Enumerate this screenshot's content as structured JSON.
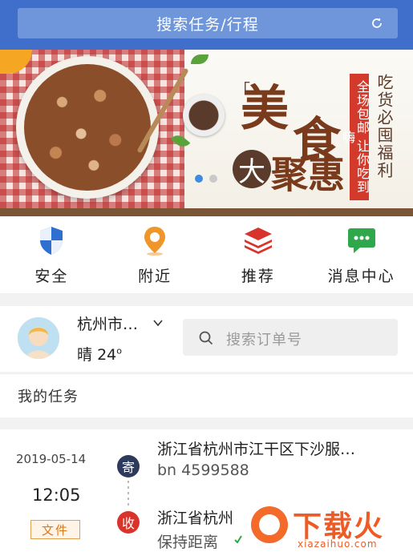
{
  "top_search": {
    "label": "搜索任务/行程",
    "icon": "refresh-icon"
  },
  "banner": {
    "headline_1": "美",
    "headline_2": "食",
    "headline_3": "大",
    "headline_4": "聚惠",
    "red_tag": "全场包邮 让你吃到嗨",
    "vertical_text": "吃货必囤福利",
    "bracket_left": "「",
    "pager_total": 2,
    "pager_active": 1
  },
  "quick_nav": [
    {
      "label": "安全",
      "icon": "shield-icon",
      "color": "#2f6fd0"
    },
    {
      "label": "附近",
      "icon": "location-pin-icon",
      "color": "#f0952a"
    },
    {
      "label": "推荐",
      "icon": "layers-icon",
      "color": "#d9342b"
    },
    {
      "label": "消息中心",
      "icon": "chat-icon",
      "color": "#2ea84b"
    }
  ],
  "location": {
    "city": "杭州市…",
    "weather_label": "晴",
    "temperature": "24",
    "temp_unit": "o",
    "order_search_placeholder": "搜索订单号"
  },
  "task_section": {
    "title": "我的任务"
  },
  "task": {
    "date": "2019-05-14",
    "time": "12:05",
    "badge": "文件",
    "from_marker": "寄",
    "from_address": "浙江省杭州市江干区下沙服…",
    "from_number": "bn 4599588",
    "to_marker": "收",
    "to_address": "浙江省杭州",
    "to_note": "保持距离"
  },
  "watermark": {
    "title": "下载火",
    "subtitle": "xiazaihuo.com"
  }
}
